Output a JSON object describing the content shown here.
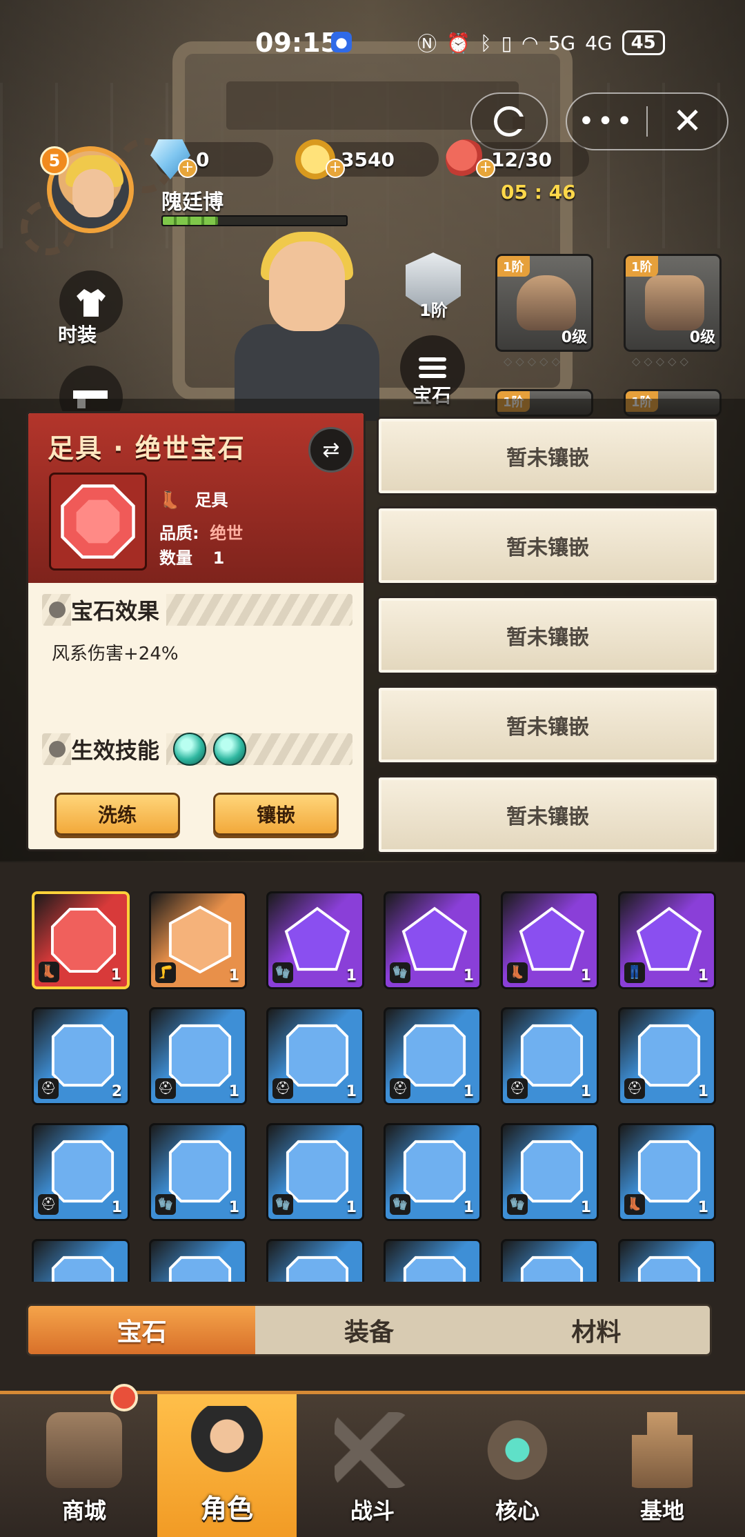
{
  "status_bar": {
    "time": "09:15",
    "network_5g": "5G",
    "network_4g": "4G",
    "battery": "45"
  },
  "player": {
    "level": "5",
    "name": "隗廷博",
    "exp_fraction": 0.3
  },
  "resources": {
    "diamonds": "0",
    "coins": "3540",
    "stamina": "12/30",
    "stamina_timer": "05 : 46"
  },
  "side_menu": {
    "fashion_label": "时装"
  },
  "character": {
    "rank_label": "1阶",
    "gem_menu_label": "宝石"
  },
  "equipment_slots": [
    {
      "tier": "1阶",
      "level": "0级"
    },
    {
      "tier": "1阶",
      "level": "0级"
    },
    {
      "tier": "1阶",
      "level": ""
    },
    {
      "tier": "1阶",
      "level": ""
    }
  ],
  "gem_detail": {
    "title": "足具 · 绝世宝石",
    "slot_label": "足具",
    "quality_key": "品质:",
    "quality_value": "绝世",
    "quantity_key": "数量",
    "quantity_value": "1",
    "effect_heading": "宝石效果",
    "effect_text": "风系伤害+24%",
    "skill_heading": "生效技能",
    "refine_button": "洗练",
    "inlay_button": "镶嵌"
  },
  "sockets": [
    "暂未镶嵌",
    "暂未镶嵌",
    "暂未镶嵌",
    "暂未镶嵌",
    "暂未镶嵌"
  ],
  "inventory": [
    {
      "color": "red",
      "slot": "boot",
      "count": "1",
      "selected": true
    },
    {
      "color": "orange",
      "slot": "leg",
      "count": "1"
    },
    {
      "color": "purple",
      "slot": "glove",
      "count": "1"
    },
    {
      "color": "purple",
      "slot": "glove",
      "count": "1"
    },
    {
      "color": "purple",
      "slot": "boot",
      "count": "1"
    },
    {
      "color": "purple",
      "slot": "pants",
      "count": "1"
    },
    {
      "color": "blue",
      "slot": "helmet",
      "count": "2"
    },
    {
      "color": "blue",
      "slot": "helmet",
      "count": "1"
    },
    {
      "color": "blue",
      "slot": "helmet",
      "count": "1"
    },
    {
      "color": "blue",
      "slot": "helmet",
      "count": "1"
    },
    {
      "color": "blue",
      "slot": "helmet",
      "count": "1"
    },
    {
      "color": "blue",
      "slot": "helmet",
      "count": "1"
    },
    {
      "color": "blue",
      "slot": "helmet",
      "count": "1"
    },
    {
      "color": "blue",
      "slot": "glove",
      "count": "1"
    },
    {
      "color": "blue",
      "slot": "glove",
      "count": "1"
    },
    {
      "color": "blue",
      "slot": "glove",
      "count": "1"
    },
    {
      "color": "blue",
      "slot": "glove",
      "count": "1"
    },
    {
      "color": "blue",
      "slot": "boot",
      "count": "1"
    },
    {
      "color": "blue",
      "slot": "helmet",
      "count": ""
    },
    {
      "color": "blue",
      "slot": "helmet",
      "count": ""
    },
    {
      "color": "blue",
      "slot": "helmet",
      "count": ""
    },
    {
      "color": "blue",
      "slot": "helmet",
      "count": ""
    },
    {
      "color": "blue",
      "slot": "helmet",
      "count": ""
    },
    {
      "color": "blue",
      "slot": "helmet",
      "count": ""
    }
  ],
  "tabs": {
    "gems": "宝石",
    "equipment": "装备",
    "materials": "材料"
  },
  "bottom_nav": {
    "shop": "商城",
    "character": "角色",
    "battle": "战斗",
    "core": "核心",
    "base": "基地"
  },
  "colors": {
    "red": "#d83a3a",
    "orange": "#e8904a",
    "purple": "#8a3fd8",
    "blue": "#3e8fd6",
    "accent": "#f19a24"
  }
}
